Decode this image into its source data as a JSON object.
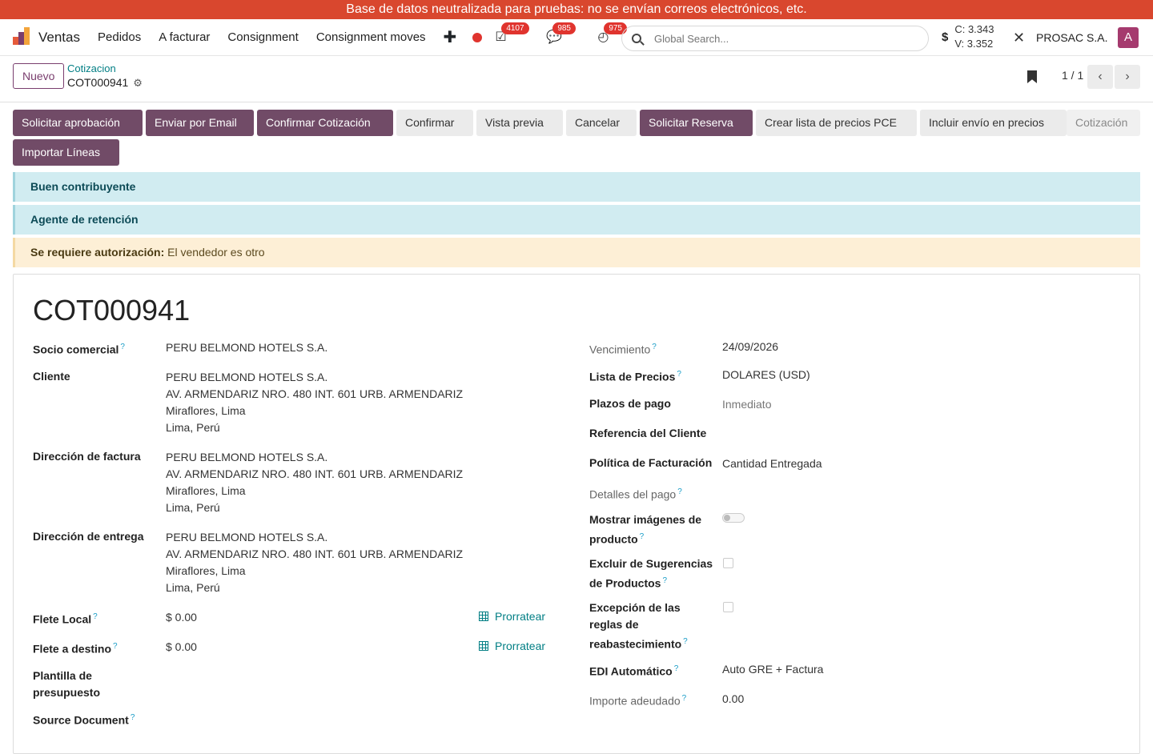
{
  "banner": "Base de datos neutralizada para pruebas: no se envían correos electrónicos, etc.",
  "nav": {
    "app_name": "Ventas",
    "menu": [
      "Pedidos",
      "A facturar",
      "Consignment",
      "Consignment moves"
    ],
    "badges": {
      "activities": "4107",
      "messages": "985",
      "timers": "975"
    },
    "search_placeholder": "Global Search...",
    "rate_c": "C: 3.343",
    "rate_v": "V: 3.352",
    "company": "PROSAC S.A.",
    "avatar": "A"
  },
  "control": {
    "new_label": "Nuevo",
    "breadcrumb_parent": "Cotizacion",
    "breadcrumb_current": "COT000941",
    "pager": "1 / 1"
  },
  "actions": {
    "solicitar_aprobacion": "Solicitar aprobación",
    "enviar_email": "Enviar por Email",
    "confirmar_cotizacion": "Confirmar Cotización",
    "confirmar": "Confirmar",
    "vista_previa": "Vista previa",
    "cancelar": "Cancelar",
    "solicitar_reserva": "Solicitar Reserva",
    "crear_lista_precios": "Crear lista de precios PCE",
    "incluir_envio": "Incluir envío en precios",
    "stage": "Cotización",
    "importar_lineas": "Importar Líneas"
  },
  "alerts": {
    "buen_contribuyente": "Buen contribuyente",
    "agente_retencion": "Agente de retención",
    "auth_label": "Se requiere autorización:",
    "auth_text": " El vendedor es otro"
  },
  "form": {
    "title": "COT000941",
    "socio_label": "Socio comercial",
    "socio_value": "PERU BELMOND HOTELS S.A.",
    "cliente_label": "Cliente",
    "direccion_factura_label": "Dirección de factura",
    "direccion_entrega_label": "Dirección de entrega",
    "address": {
      "line1": "PERU BELMOND HOTELS S.A.",
      "line2": "AV. ARMENDARIZ NRO. 480 INT. 601 URB. ARMENDARIZ",
      "line3": "Miraflores, Lima",
      "line4": "Lima, Perú"
    },
    "flete_local_label": "Flete Local",
    "flete_local_value": "$ 0.00",
    "flete_destino_label": "Flete a destino",
    "flete_destino_value": "$ 0.00",
    "prorratear": "Prorratear",
    "plantilla_label": "Plantilla de presupuesto",
    "source_label": "Source Document",
    "vencimiento_label": "Vencimiento",
    "vencimiento_value": "24/09/2026",
    "lista_precios_label": "Lista de Precios",
    "lista_precios_value": "DOLARES (USD)",
    "plazos_label": "Plazos de pago",
    "plazos_value": "Inmediato",
    "referencia_label": "Referencia del Cliente",
    "politica_label": "Política de Facturación",
    "politica_value": "Cantidad Entregada",
    "detalles_pago_label": "Detalles del pago",
    "mostrar_imagenes_label": "Mostrar imágenes de producto",
    "excluir_label": "Excluir de Sugerencias de Productos",
    "excepcion_label": "Excepción de las reglas de reabastecimiento",
    "edi_label": "EDI Automático",
    "edi_value": "Auto GRE + Factura",
    "importe_label": "Importe adeudado",
    "importe_value": "0.00"
  }
}
